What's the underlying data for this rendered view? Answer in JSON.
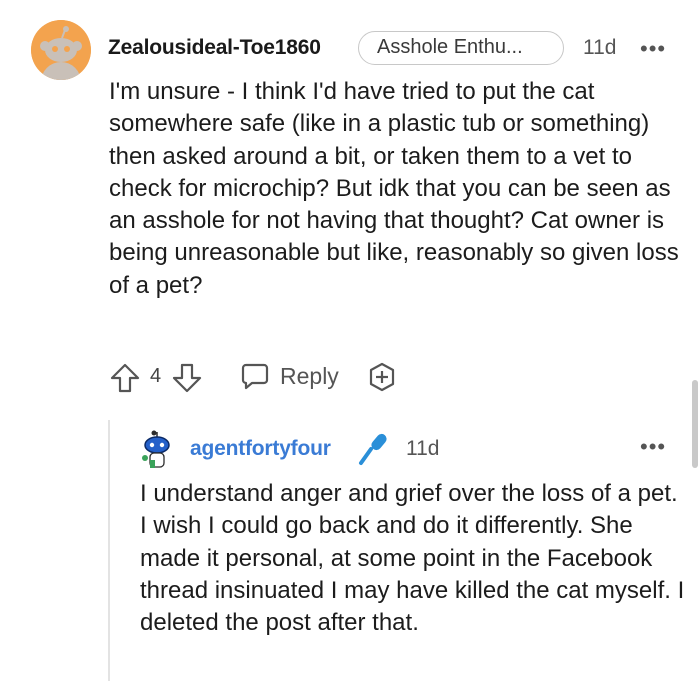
{
  "comment": {
    "username": "Zealousideal-Toe1860",
    "flair": "Asshole Enthu...",
    "time": "11d",
    "more": "•••",
    "body": "I'm unsure - I think I'd have tried to put the cat somewhere safe (like in a plastic tub or something) then asked around a bit, or taken them to a vet to check for microchip? But idk that you can be seen as an asshole for not having that thought? Cat owner is being unreasonable but like, reasonably so given loss of a pet?",
    "votes": "4",
    "reply_label": "Reply",
    "avatar_color": "#f3a34e"
  },
  "reply": {
    "username": "agentfortyfour",
    "time": "11d",
    "more": "•••",
    "body": "I understand anger and grief over the loss of a pet. I wish I could go back and do it differently. She made it personal, at some point in the Facebook thread insinuated I may have killed the cat myself. I deleted the post after that.",
    "username_color": "#3a7bd5"
  }
}
